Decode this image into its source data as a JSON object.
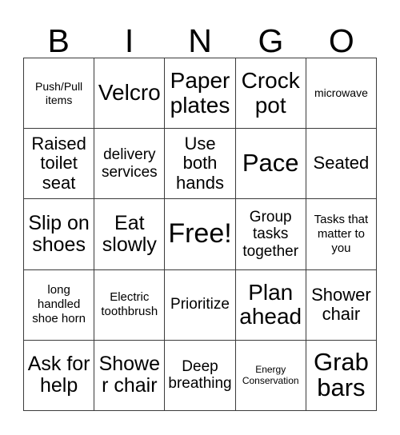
{
  "card": {
    "title": "BINGO",
    "header_letters": [
      "B",
      "I",
      "N",
      "G",
      "O"
    ],
    "grid_size": "5x5",
    "free_space_label": "Free!",
    "colors": {
      "background": "#ffffff",
      "text": "#000000",
      "border": "#3b3b3b"
    },
    "rows": [
      [
        {
          "text": "Push/Pull items",
          "size": "sm"
        },
        {
          "text": "Velcro",
          "size": "3xl"
        },
        {
          "text": "Paper plates",
          "size": "3xl"
        },
        {
          "text": "Crock pot",
          "size": "3xl"
        },
        {
          "text": "microwave",
          "size": "sm"
        }
      ],
      [
        {
          "text": "Raised toilet seat",
          "size": "xl"
        },
        {
          "text": "delivery services",
          "size": "lg"
        },
        {
          "text": "Use both hands",
          "size": "xl"
        },
        {
          "text": "Pace",
          "size": "4xl"
        },
        {
          "text": "Seated",
          "size": "xl"
        }
      ],
      [
        {
          "text": "Slip on shoes",
          "size": "2xl"
        },
        {
          "text": "Eat slowly",
          "size": "2xl"
        },
        {
          "text": "Free!",
          "size": "5xl"
        },
        {
          "text": "Group tasks together",
          "size": "lg"
        },
        {
          "text": "Tasks that matter to you",
          "size": "md"
        }
      ],
      [
        {
          "text": "long handled shoe horn",
          "size": "md"
        },
        {
          "text": "Electric toothbrush",
          "size": "md"
        },
        {
          "text": "Prioritize",
          "size": "lg"
        },
        {
          "text": "Plan ahead",
          "size": "3xl"
        },
        {
          "text": "Shower chair",
          "size": "xl"
        }
      ],
      [
        {
          "text": "Ask for help",
          "size": "2xl"
        },
        {
          "text": "Shower chair",
          "size": "2xl"
        },
        {
          "text": "Deep breathing",
          "size": "lg"
        },
        {
          "text": "Energy Conservation",
          "size": "xs"
        },
        {
          "text": "Grab bars",
          "size": "4xl"
        }
      ]
    ]
  }
}
